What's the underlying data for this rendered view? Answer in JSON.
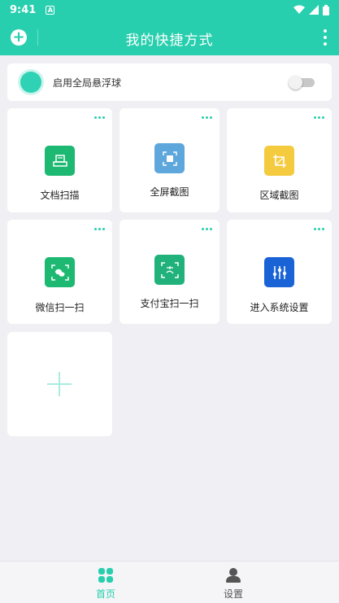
{
  "status_bar": {
    "time": "9:41",
    "notification_glyph": "A"
  },
  "header": {
    "title": "我的快捷方式",
    "add_icon": "plus-circle-icon",
    "more_icon": "more-vert-icon"
  },
  "floating_ball": {
    "label": "启用全局悬浮球",
    "enabled": false
  },
  "shortcuts": [
    {
      "name": "文档扫描",
      "icon": "document-scan-icon",
      "color": "#1db872"
    },
    {
      "name": "全屏截图",
      "icon": "fullscreen-screenshot-icon",
      "color": "#5ea7dc"
    },
    {
      "name": "区域截图",
      "icon": "crop-icon",
      "color": "#f4cb3f"
    },
    {
      "name": "微信扫一扫",
      "icon": "wechat-scan-icon",
      "color": "#1db872"
    },
    {
      "name": "支付宝扫一扫",
      "icon": "alipay-scan-icon",
      "color": "#20b27a"
    },
    {
      "name": "进入系统设置",
      "icon": "system-settings-icon",
      "color": "#1a63d6"
    }
  ],
  "bottom_nav": [
    {
      "label": "首页",
      "icon": "grid-icon",
      "active": true
    },
    {
      "label": "设置",
      "icon": "person-icon",
      "active": false
    }
  ],
  "colors": {
    "accent": "#27cfae",
    "background": "#f0f0f4"
  }
}
